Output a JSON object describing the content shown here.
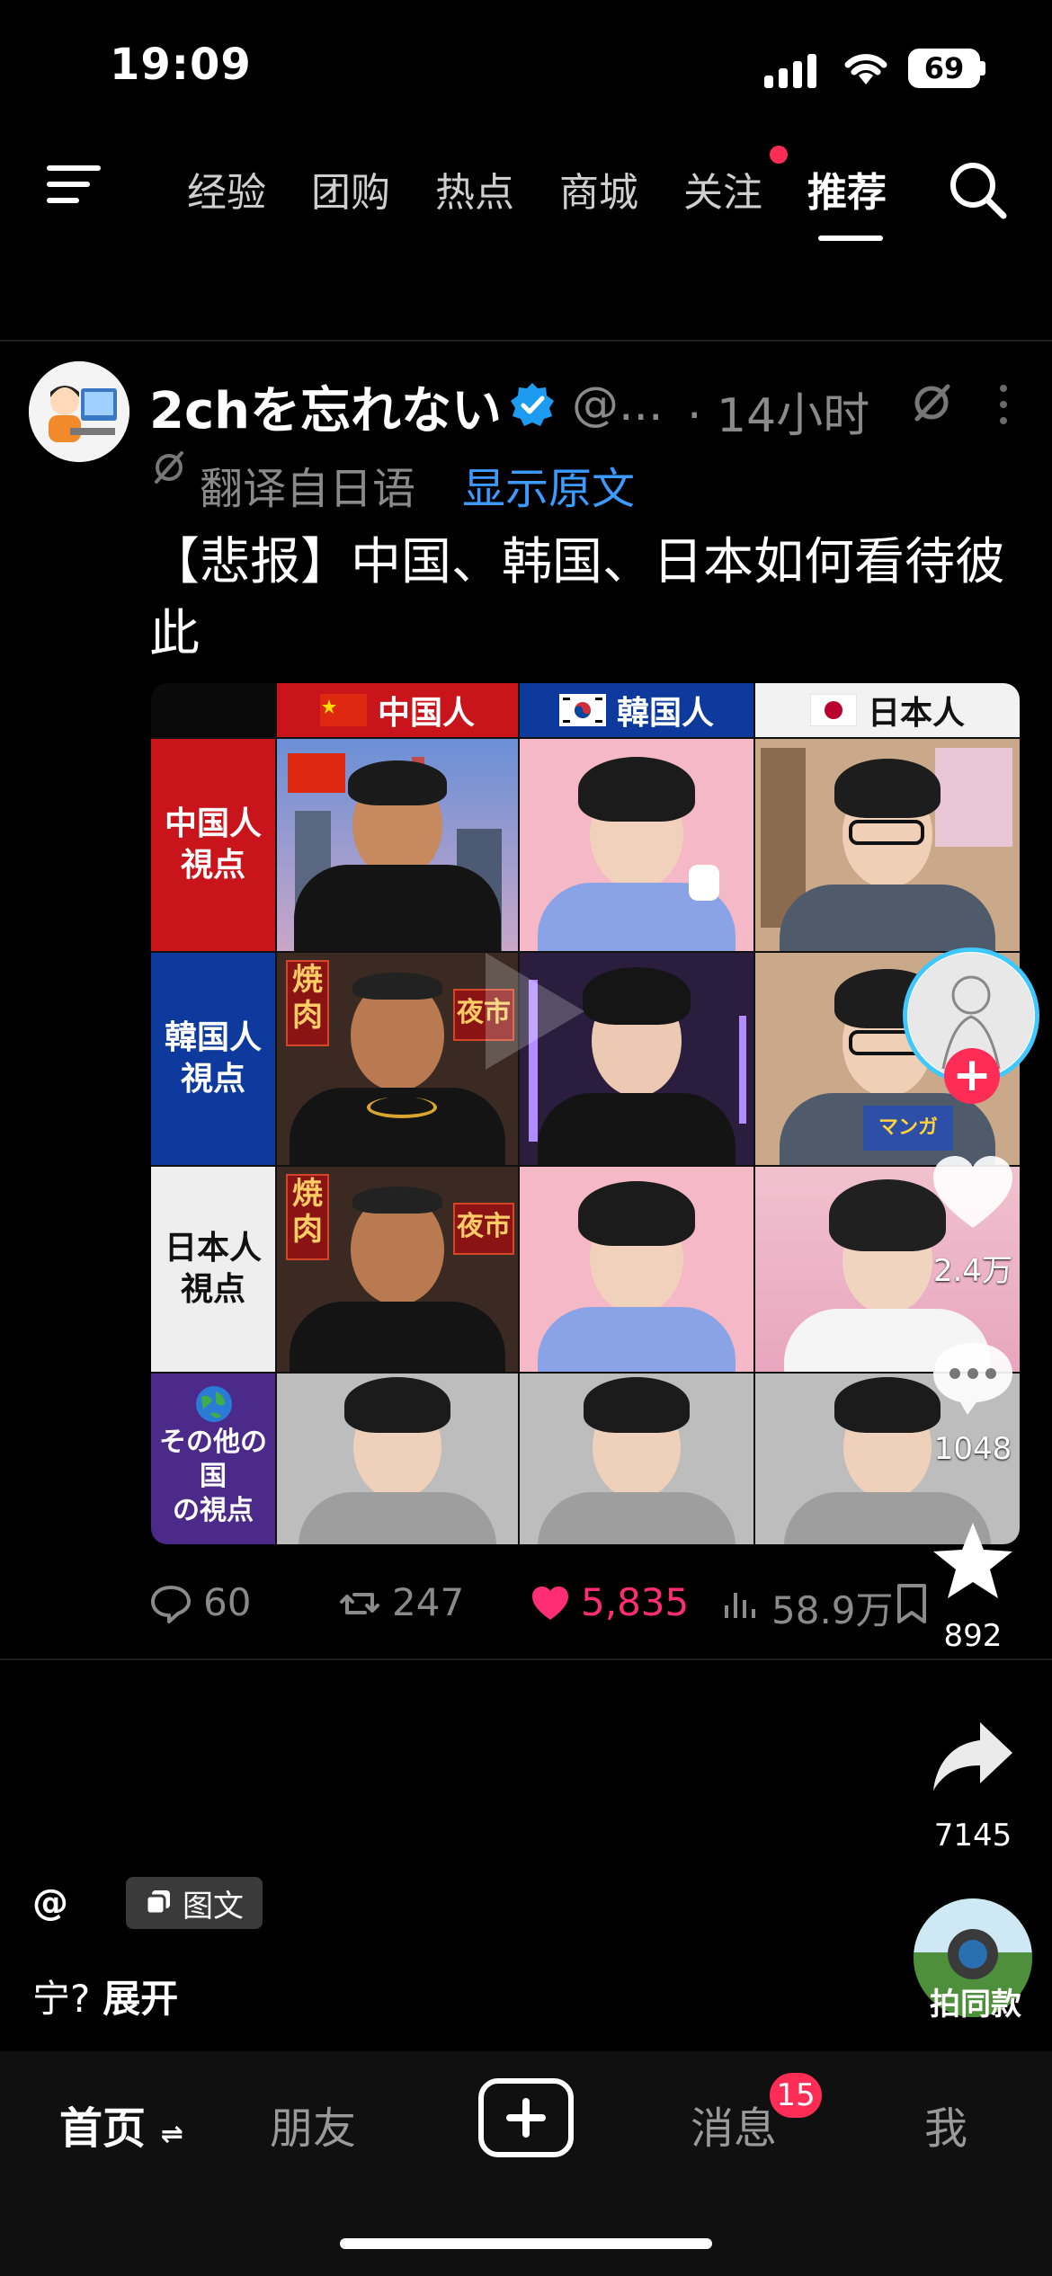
{
  "status_bar": {
    "time": "19:09",
    "battery": "69"
  },
  "nav": {
    "tabs": [
      {
        "label": "经验"
      },
      {
        "label": "团购"
      },
      {
        "label": "热点"
      },
      {
        "label": "商城"
      },
      {
        "label": "关注"
      },
      {
        "label": "推荐"
      }
    ],
    "active_tab": "推荐"
  },
  "post": {
    "author": "2chを忘れない",
    "handle": "@...",
    "time": "· 14小时",
    "translated_label": "翻译自日语",
    "show_original": "显示原文",
    "text": "【悲报】中国、韩国、日本如何看待彼此",
    "image": {
      "col_headers": [
        "中国人",
        "韓国人",
        "日本人"
      ],
      "row_headers": [
        "中国人\n視点",
        "韓国人\n視点",
        "日本人\n視点",
        "その他の国\nの視点"
      ],
      "sign_left": "焼\n肉",
      "sign_right": "夜市",
      "manga_label": "マンガ"
    },
    "stats": {
      "replies": "60",
      "reposts": "247",
      "likes": "5,835",
      "views": "58.9万"
    }
  },
  "rail": {
    "likes": "2.4万",
    "comments": "1048",
    "favorites": "892",
    "shares": "7145",
    "same_style": "拍同款"
  },
  "overlay": {
    "at": "@",
    "type_label": "图文",
    "caption": "宁?",
    "expand": "展开"
  },
  "tabbar": {
    "home": "首页",
    "friends": "朋友",
    "messages": "消息",
    "messages_badge": "15",
    "me": "我"
  },
  "colors": {
    "accent_blue": "#3c9bff",
    "like_pink": "#ff2d73",
    "badge_red": "#ff2d55"
  }
}
